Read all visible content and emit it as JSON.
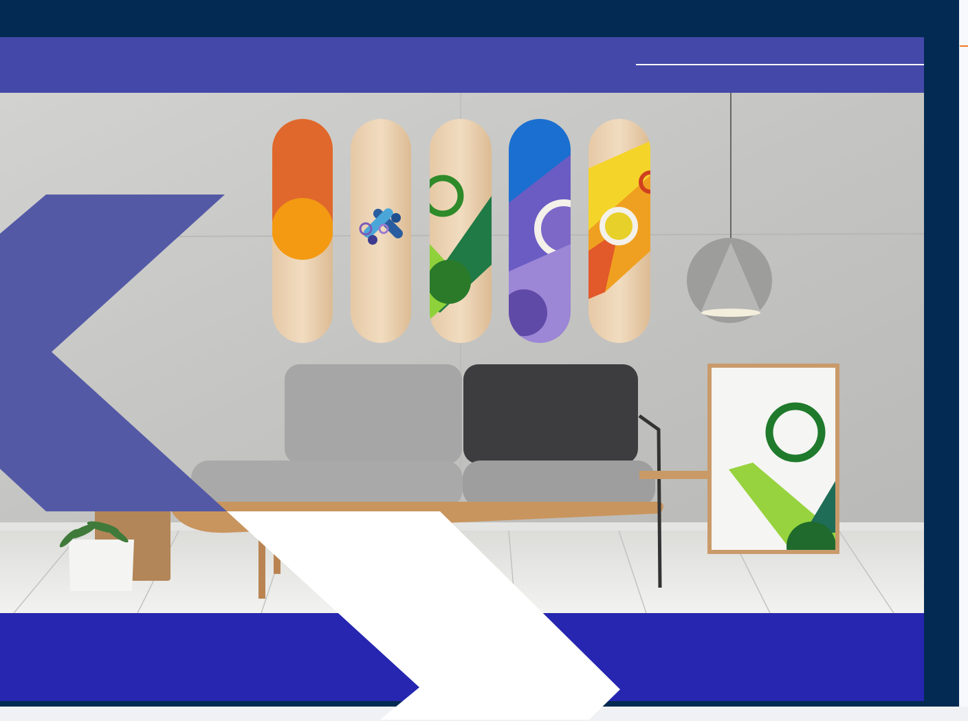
{
  "colors": {
    "navy": "#022a52",
    "header_band": "#4448a8",
    "bottom_band": "#2626b0",
    "left_chevron": "#5459a6",
    "white_chevron": "#ffffff",
    "accent_orange": "#f07a2a",
    "wall": "#c9c9c7",
    "floor": "#e6e6e3"
  },
  "icons": {
    "left_chevron": "chevron-left-shape",
    "right_chevron": "chevron-right-shape",
    "brand_mark": "x-logo-icon"
  }
}
